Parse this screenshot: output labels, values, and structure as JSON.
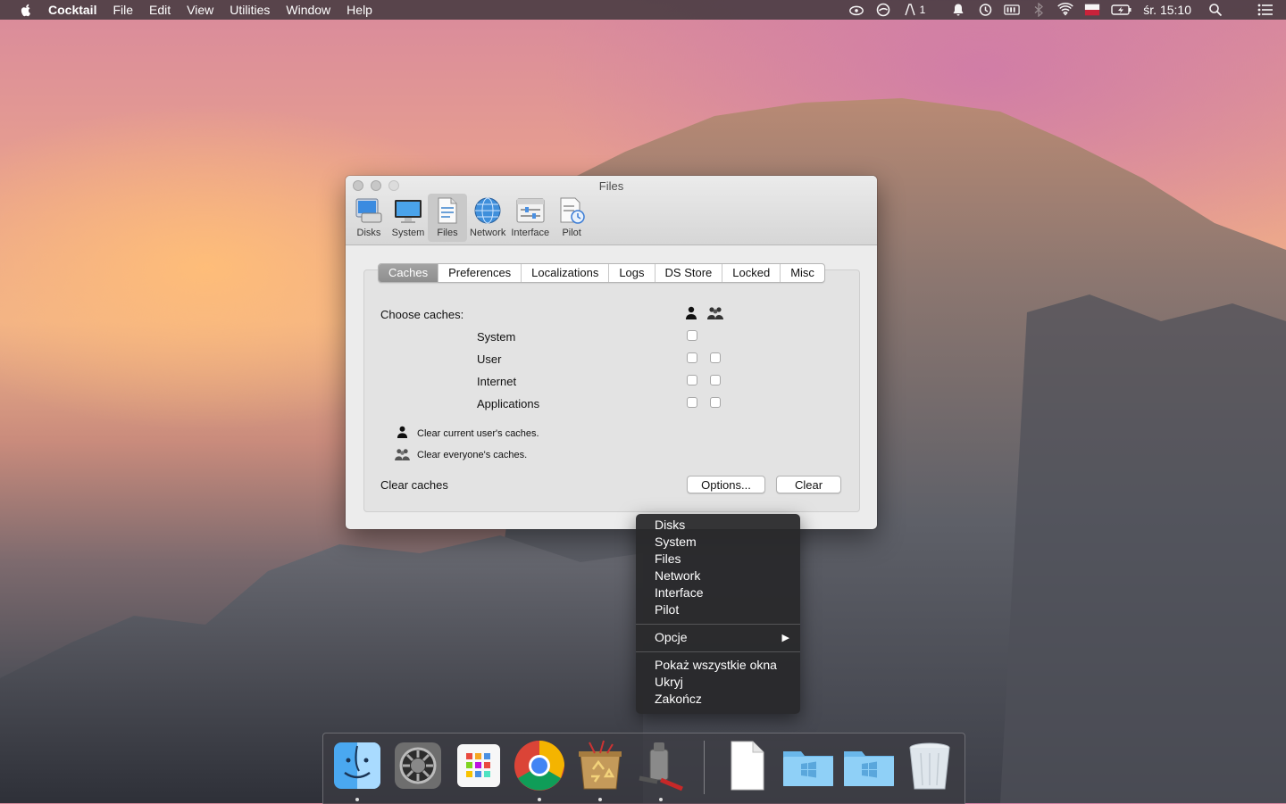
{
  "menubar": {
    "app_name": "Cocktail",
    "items": [
      "File",
      "Edit",
      "View",
      "Utilities",
      "Window",
      "Help"
    ],
    "status_icons": [
      "cloud-icon",
      "no-sign-icon",
      "notification-count-icon",
      "bell-icon",
      "time-machine-icon",
      "battery-meter-icon",
      "bluetooth-icon",
      "wifi-icon",
      "flag-pro-icon",
      "battery-icon"
    ],
    "notification_count": "1",
    "clock": "śr. 15:10"
  },
  "window": {
    "title": "Files",
    "toolbar": [
      {
        "label": "Disks",
        "icon": "disks-icon"
      },
      {
        "label": "System",
        "icon": "monitor-icon"
      },
      {
        "label": "Files",
        "icon": "files-icon"
      },
      {
        "label": "Network",
        "icon": "globe-icon"
      },
      {
        "label": "Interface",
        "icon": "interface-icon"
      },
      {
        "label": "Pilot",
        "icon": "pilot-icon"
      }
    ],
    "active_tool": "Files",
    "tabs": [
      "Caches",
      "Preferences",
      "Localizations",
      "Logs",
      "DS Store",
      "Locked",
      "Misc"
    ],
    "active_tab": "Caches",
    "choose_label": "Choose caches:",
    "cache_rows": [
      {
        "label": "System",
        "user": false,
        "everyone": null
      },
      {
        "label": "User",
        "user": false,
        "everyone": false
      },
      {
        "label": "Internet",
        "user": false,
        "everyone": false
      },
      {
        "label": "Applications",
        "user": false,
        "everyone": false
      }
    ],
    "legend": {
      "user": "Clear current user's caches.",
      "everyone": "Clear everyone's caches."
    },
    "footer_label": "Clear caches",
    "options_button": "Options...",
    "clear_button": "Clear"
  },
  "context_menu": {
    "group1": [
      "Disks",
      "System",
      "Files",
      "Network",
      "Interface",
      "Pilot"
    ],
    "submenu": "Opcje",
    "group3": [
      "Pokaż wszystkie okna",
      "Ukryj",
      "Zakończ"
    ]
  },
  "dock": {
    "apps": [
      "finder-icon",
      "system-preferences-icon",
      "launchpad-icon",
      "chrome-icon",
      "cleaner-icon",
      "cocktail-icon"
    ],
    "others": [
      "document-icon",
      "windows-folder-icon",
      "windows-folder-icon-2",
      "trash-icon"
    ]
  }
}
